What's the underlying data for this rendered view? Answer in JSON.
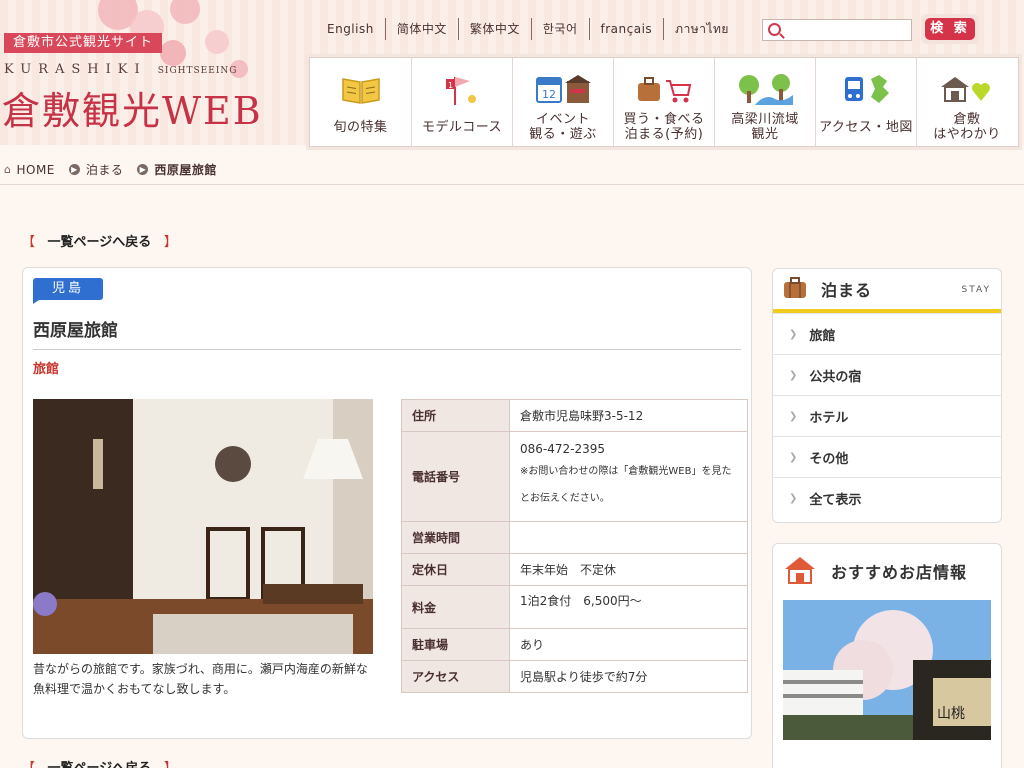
{
  "header": {
    "tagline": "倉敷市公式観光サイト",
    "brand_sub": "KURASHIKI",
    "brand_sub_small": "SIGHTSEEING",
    "brand_main": "倉敷観光WEB",
    "languages": [
      "English",
      "简体中文",
      "繁体中文",
      "한국어",
      "français",
      "ภาษาไทย"
    ],
    "search_placeholder": "",
    "search_button": "検 索",
    "nav": [
      {
        "label": "旬の特集",
        "icon": "open-book-icon"
      },
      {
        "label": "モデルコース",
        "icon": "flag-course-icon"
      },
      {
        "label": "イベント\n観る・遊ぶ",
        "icon": "calendar-icon"
      },
      {
        "label": "買う・食べる\n泊まる(予約)",
        "icon": "shopping-icon"
      },
      {
        "label": "高梁川流域\n観光",
        "icon": "river-trees-icon"
      },
      {
        "label": "アクセス・地図",
        "icon": "train-map-icon"
      },
      {
        "label": "倉敷\nはやわかり",
        "icon": "house-heart-icon"
      }
    ],
    "accent_color": "#d5334a"
  },
  "breadcrumb": {
    "home": "HOME",
    "level1": "泊まる",
    "current": "西原屋旅館"
  },
  "back_link": "一覧ページへ戻る",
  "facility": {
    "area": "児島",
    "name": "西原屋旅館",
    "category": "旅館",
    "description": "昔ながらの旅館です。家族づれ、商用に。瀬戸内海産の新鮮な魚料理で温かくおもてなし致します。",
    "info": [
      {
        "label": "住所",
        "value": "倉敷市児島味野3-5-12",
        "note": ""
      },
      {
        "label": "電話番号",
        "value": "086-472-2395",
        "note": "※お問い合わせの際は「倉敷観光WEB」を見たとお伝えください。"
      },
      {
        "label": "営業時間",
        "value": "",
        "note": ""
      },
      {
        "label": "定休日",
        "value": "年末年始　不定休",
        "note": ""
      },
      {
        "label": "料金",
        "value": "1泊2食付　6,500円〜",
        "note": ""
      },
      {
        "label": "駐車場",
        "value": "あり",
        "note": ""
      },
      {
        "label": "アクセス",
        "value": "児島駅より徒歩で約7分",
        "note": ""
      }
    ]
  },
  "sidebar": {
    "stay_title": "泊まる",
    "stay_en": "STAY",
    "stay_items": [
      "旅館",
      "公共の宿",
      "ホテル",
      "その他",
      "全て表示"
    ],
    "recommend_title": "おすすめお店情報",
    "highlight_color": "#f2cc1d"
  }
}
